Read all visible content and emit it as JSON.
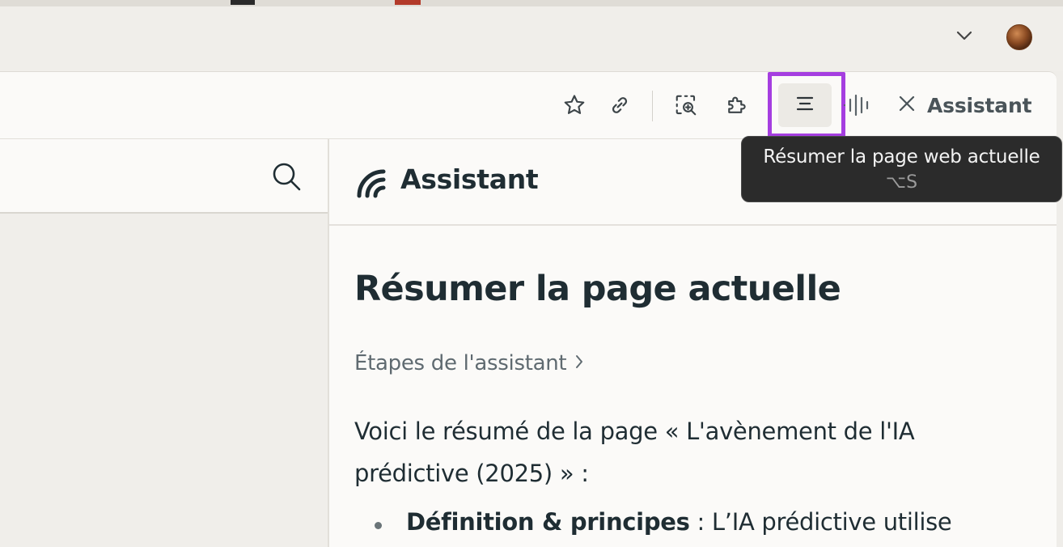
{
  "colors": {
    "highlight": "#a53ee0",
    "text_dark": "#1f2d33",
    "text_muted": "#5f6a70",
    "tooltip_bg": "#2b2b2b"
  },
  "tab_bar": {
    "icons": [
      "chevron-down-icon",
      "profile-avatar"
    ]
  },
  "toolbar": {
    "icons": [
      "bookmark-star-icon",
      "link-icon",
      "screenshot-search-icon",
      "extensions-puzzle-icon",
      "summarize-icon",
      "voice-waveform-icon",
      "close-icon"
    ],
    "assistant_label": "Assistant"
  },
  "tooltip": {
    "text": "Résumer la page web actuelle",
    "shortcut": "⌥S"
  },
  "left_pane": {
    "icons": [
      "search-icon"
    ]
  },
  "assistant_panel": {
    "title": "Assistant",
    "heading": "Résumer la page actuelle",
    "steps_link": "Étapes de l'assistant",
    "intro_line1": "Voici le résumé de la page « L'avènement de l'IA",
    "intro_line2": "prédictive (2025) » :",
    "bullets": [
      {
        "term": "Définition & principes",
        "text": " : L’IA prédictive utilise"
      }
    ]
  }
}
